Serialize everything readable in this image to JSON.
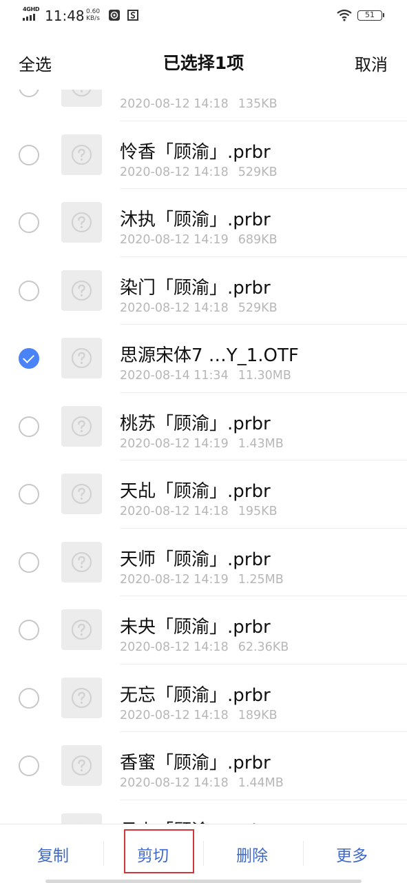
{
  "status_bar": {
    "network": "4GHD",
    "time": "11:48",
    "speed_value": "0.60",
    "speed_unit": "KB/s",
    "battery": "51"
  },
  "header": {
    "select_all": "全选",
    "title": "已选择1项",
    "cancel": "取消"
  },
  "files": [
    {
      "name": "",
      "date": "2020-08-12 14:18",
      "size": "135KB",
      "selected": false
    },
    {
      "name": "怜香「顾渝」.prbr",
      "date": "2020-08-12 14:18",
      "size": "529KB",
      "selected": false
    },
    {
      "name": "沐执「顾渝」.prbr",
      "date": "2020-08-12 14:19",
      "size": "689KB",
      "selected": false
    },
    {
      "name": "染门「顾渝」.prbr",
      "date": "2020-08-12 14:18",
      "size": "529KB",
      "selected": false
    },
    {
      "name": "思源宋体7 …Y_1.OTF",
      "date": "2020-08-14 11:34",
      "size": "11.30MB",
      "selected": true
    },
    {
      "name": "桃苏「顾渝」.prbr",
      "date": "2020-08-12 14:19",
      "size": "1.43MB",
      "selected": false
    },
    {
      "name": "天乩「顾渝」.prbr",
      "date": "2020-08-12 14:18",
      "size": "195KB",
      "selected": false
    },
    {
      "name": "天师「顾渝」.prbr",
      "date": "2020-08-12 14:19",
      "size": "1.25MB",
      "selected": false
    },
    {
      "name": "未央「顾渝」.prbr",
      "date": "2020-08-12 14:18",
      "size": "62.36KB",
      "selected": false
    },
    {
      "name": "无忘「顾渝」.prbr",
      "date": "2020-08-12 14:18",
      "size": "189KB",
      "selected": false
    },
    {
      "name": "香蜜「顾渝」.prbr",
      "date": "2020-08-12 14:18",
      "size": "1.44MB",
      "selected": false
    },
    {
      "name": "月上「顾渝」.prbr",
      "date": "",
      "size": "",
      "selected": false
    }
  ],
  "bottom_bar": {
    "copy": "复制",
    "cut": "剪切",
    "delete": "删除",
    "more": "更多"
  },
  "colors": {
    "accent": "#4a82f7",
    "action_text": "#3e69c9",
    "highlight_border": "#d0363b",
    "meta_text": "#b7b7b7",
    "thumb_bg": "#ececec"
  }
}
